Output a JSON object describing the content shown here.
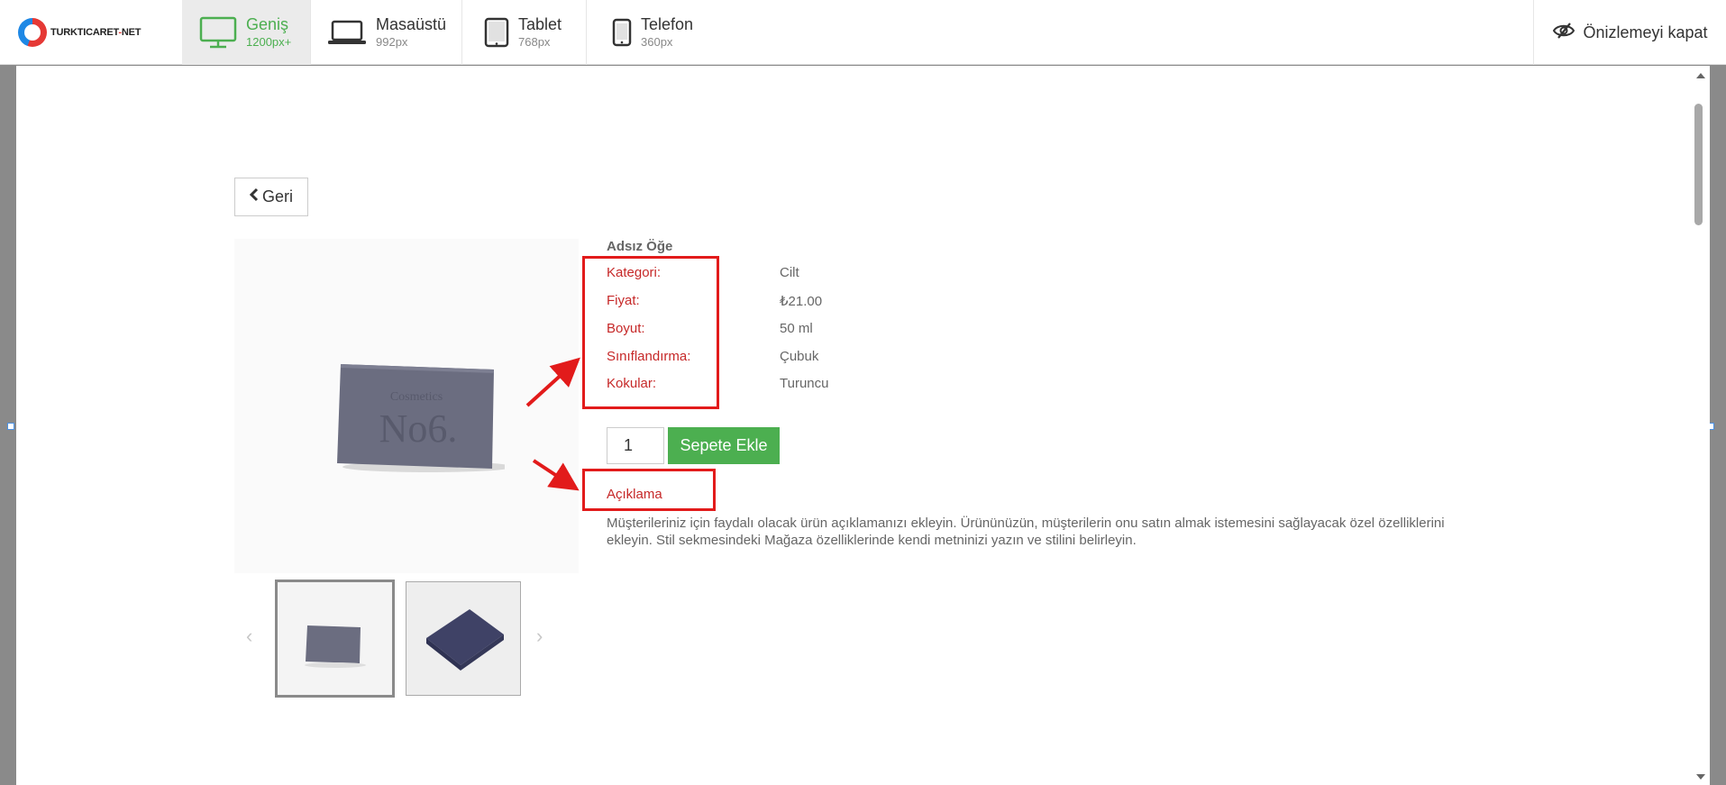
{
  "toolbar": {
    "logo": {
      "text_main": "TURKTICARET",
      "text_sep": "-",
      "text_net": "NET"
    },
    "devices": [
      {
        "name": "Geniş",
        "size": "1200px+",
        "icon": "monitor-icon",
        "active": true
      },
      {
        "name": "Masaüstü",
        "size": "992px",
        "icon": "laptop-icon",
        "active": false
      },
      {
        "name": "Tablet",
        "size": "768px",
        "icon": "tablet-icon",
        "active": false
      },
      {
        "name": "Telefon",
        "size": "360px",
        "icon": "phone-icon",
        "active": false
      }
    ],
    "close_preview": {
      "label": "Önizlemeyi kapat",
      "icon": "eye-slash-icon"
    }
  },
  "page": {
    "back_label": "Geri",
    "product_title": "Adsız Öğe",
    "attributes": [
      {
        "key": "Kategori:",
        "value": "Cilt"
      },
      {
        "key": "Fiyat:",
        "value": "₺21.00"
      },
      {
        "key": "Boyut:",
        "value": "50 ml"
      },
      {
        "key": "Sınıflandırma:",
        "value": "Çubuk"
      },
      {
        "key": "Kokular:",
        "value": "Turuncu"
      }
    ],
    "quantity": "1",
    "add_to_cart": "Sepete Ekle",
    "description_title": "Açıklama",
    "description_text": "Müşterileriniz için faydalı olacak ürün açıklamanızı ekleyin. Ürününüzün, müşterilerin onu satın almak istemesini sağlayacak özel özelliklerini ekleyin. Stil sekmesindeki Mağaza özelliklerinde kendi metninizi yazın ve stilini belirleyin.",
    "thumb_prev": "‹",
    "thumb_next": "›",
    "soap_label": {
      "line1": "Cosmetics",
      "line2": "No6."
    }
  },
  "colors": {
    "accent_green": "#4caf50",
    "annotation_red": "#e21b1b",
    "label_red": "#c62828"
  }
}
